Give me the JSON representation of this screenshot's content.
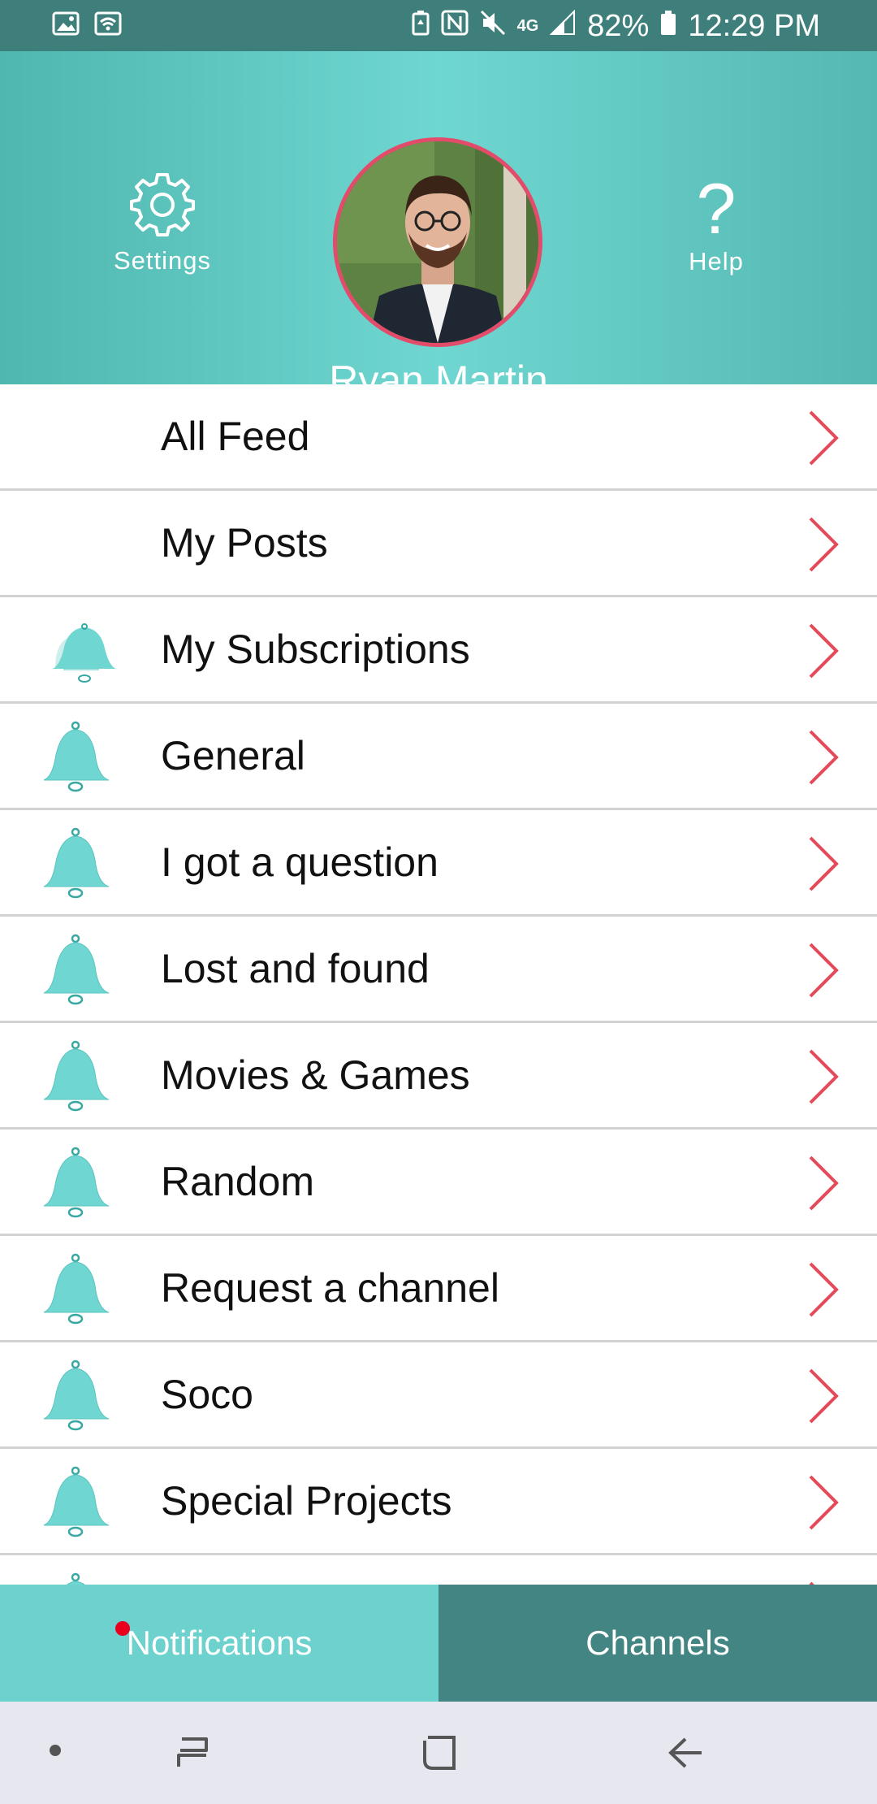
{
  "status_bar": {
    "battery": "82%",
    "time": "12:29 PM",
    "network": "4G",
    "icons": [
      "image-icon",
      "wifi-icon",
      "battery-saver-icon",
      "nfc-icon",
      "mute-icon",
      "signal-icon",
      "battery-icon"
    ]
  },
  "header": {
    "settings_label": "Settings",
    "help_label": "Help",
    "help_glyph": "?",
    "user_name": "Ryan Martin"
  },
  "list": {
    "items": [
      {
        "label": "All Feed",
        "icon": "none"
      },
      {
        "label": "My Posts",
        "icon": "none"
      },
      {
        "label": "My Subscriptions",
        "icon": "stacked-bell-icon"
      },
      {
        "label": "General",
        "icon": "bell-icon"
      },
      {
        "label": "I got a question",
        "icon": "bell-icon"
      },
      {
        "label": "Lost and found",
        "icon": "bell-icon"
      },
      {
        "label": "Movies & Games",
        "icon": "bell-icon"
      },
      {
        "label": "Random",
        "icon": "bell-icon"
      },
      {
        "label": "Request a channel",
        "icon": "bell-icon"
      },
      {
        "label": "Soco",
        "icon": "bell-icon"
      },
      {
        "label": "Special Projects",
        "icon": "bell-icon"
      }
    ]
  },
  "tabs": {
    "notifications_label": "Notifications",
    "channels_label": "Channels"
  },
  "colors": {
    "header_teal": "#6fd6d1",
    "status_bar": "#3f7f7b",
    "bell": "#6fd6d1",
    "chevron": "#e34b5a",
    "avatar_ring": "#e34b6a",
    "tab_active": "#6dd1cd",
    "tab_inactive": "#428582",
    "notification_dot": "#e8001c"
  }
}
